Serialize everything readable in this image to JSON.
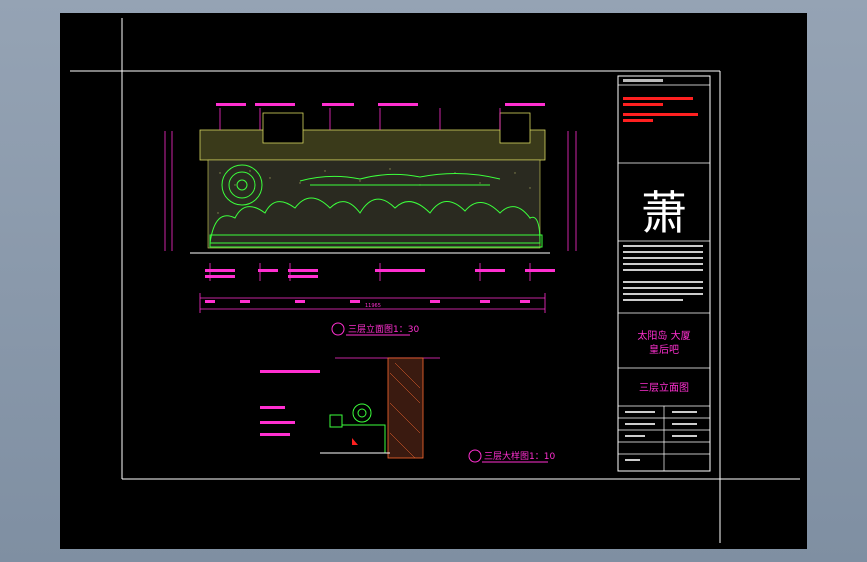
{
  "drawing": {
    "elevation_title": "三层立面图1：30",
    "detail_title": "三层大样图1：10",
    "dim_total": "11965"
  },
  "title_block": {
    "project_line1": "太阳岛 大厦",
    "project_line2": "皇后吧",
    "sheet_title": "三层立面图",
    "logo_char": "萧"
  },
  "colors": {
    "background": "#000000",
    "frame": "#ffffff",
    "dimension": "#ff2fd0",
    "outline": "#3cff3c",
    "hatch": "#d8d860"
  }
}
